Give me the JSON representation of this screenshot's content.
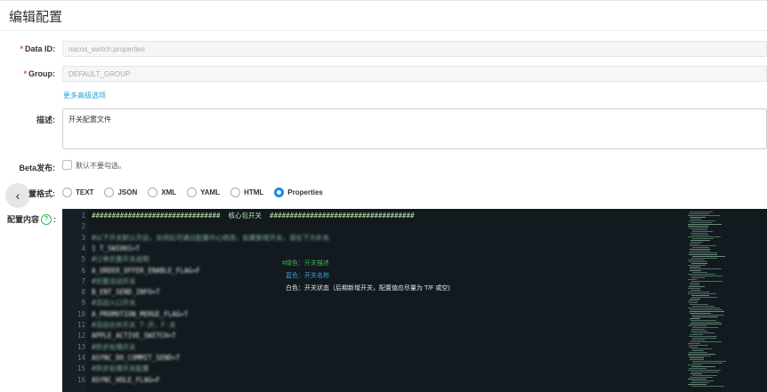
{
  "page": {
    "title": "编辑配置"
  },
  "form": {
    "data_id": {
      "label": "Data ID:",
      "required_mark": "*",
      "value": "nacos_switch.properties"
    },
    "group": {
      "label": "Group:",
      "required_mark": "*",
      "value": "DEFAULT_GROUP"
    },
    "advanced_link": "更多高级选项",
    "description": {
      "label": "描述:",
      "value": "开关配置文件"
    },
    "beta": {
      "label": "Beta发布:",
      "checked": false,
      "hint": "默认不要勾选。"
    },
    "format": {
      "label": "置格式:",
      "options": [
        "TEXT",
        "JSON",
        "XML",
        "YAML",
        "HTML",
        "Properties"
      ],
      "selected": "Properties"
    },
    "content_label": "配置内容",
    "help_icon": "question-circle-icon",
    "back_icon": "chevron-left-icon",
    "back_glyph": "‹"
  },
  "editor": {
    "lines": [
      {
        "n": "1",
        "text": "################################  核心包开关  ####################################",
        "blurred": false
      },
      {
        "n": "2",
        "text": "",
        "blurred": false
      },
      {
        "n": "3",
        "text": "#以下开关默认开启，关闭后可通过配置中心修改，如果新增开关，请在下方补充",
        "blurred": true
      },
      {
        "n": "4",
        "text": "1 T_SWI001=T",
        "blurred": true
      },
      {
        "n": "5",
        "text": "#订单优惠开关说明",
        "blurred": true
      },
      {
        "n": "6",
        "text": "A_ORDER_OFFER_ENABLE_FLAG=F",
        "blurred": true
      },
      {
        "n": "7",
        "text": "#优惠活动开关",
        "blurred": true
      },
      {
        "n": "8",
        "text": "B_ENT_SEND_INFO=T",
        "blurred": true
      },
      {
        "n": "9",
        "text": "#活动入口开关",
        "blurred": true
      },
      {
        "n": "10",
        "text": "A_PROMOTION_MERGE_FLAG=T",
        "blurred": true
      },
      {
        "n": "11",
        "text": "#活动合并开关 T-开，F-关",
        "blurred": true
      },
      {
        "n": "12",
        "text": "APPLE_ACTIVE_SWITCH=T",
        "blurred": true
      },
      {
        "n": "13",
        "text": "#异步处理开关",
        "blurred": true
      },
      {
        "n": "14",
        "text": "ASYNC_DO_COMMIT_SEND=T",
        "blurred": true
      },
      {
        "n": "15",
        "text": "#异步处理开关配置",
        "blurred": true
      },
      {
        "n": "16",
        "text": "ASYNC_HOLE_FLAG=F",
        "blurred": true
      }
    ],
    "annotations": [
      {
        "text": "#绿色：开关描述",
        "color": "#3fb34f"
      },
      {
        "text": "蓝色：开关名称",
        "color": "#3aa0e0"
      },
      {
        "text": "白色：开关状态（后期新增开关，配置值应尽量为 T/F 或空)",
        "color": "#e8e8e8"
      }
    ],
    "colors": {
      "background": "#121a1f",
      "comment": "#bfe3a8",
      "line_number": "#6b7780"
    }
  }
}
